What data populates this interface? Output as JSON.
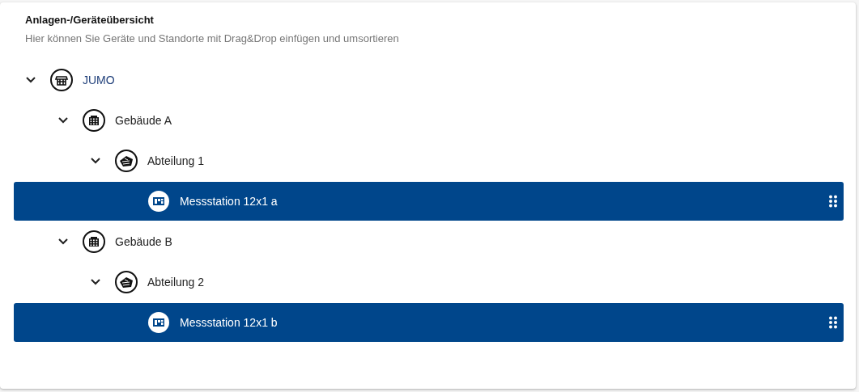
{
  "panel": {
    "title": "Anlagen-/Geräteübersicht",
    "subtitle": "Hier können Sie Geräte und Standorte mit Drag&Drop einfügen und umsortieren"
  },
  "tree": [
    {
      "label": "JUMO",
      "kind": "company",
      "expanded": true,
      "selected": false,
      "children": [
        {
          "label": "Gebäude A",
          "kind": "building",
          "expanded": true,
          "selected": false,
          "children": [
            {
              "label": "Abteilung 1",
              "kind": "department",
              "expanded": true,
              "selected": false,
              "children": [
                {
                  "label": "Messstation 12x1 a",
                  "kind": "device",
                  "selected": true
                }
              ]
            }
          ]
        },
        {
          "label": "Gebäude B",
          "kind": "building",
          "expanded": true,
          "selected": false,
          "children": [
            {
              "label": "Abteilung 2",
              "kind": "department",
              "expanded": true,
              "selected": false,
              "children": [
                {
                  "label": "Messstation 12x1 b",
                  "kind": "device",
                  "selected": true
                }
              ]
            }
          ]
        }
      ]
    }
  ]
}
